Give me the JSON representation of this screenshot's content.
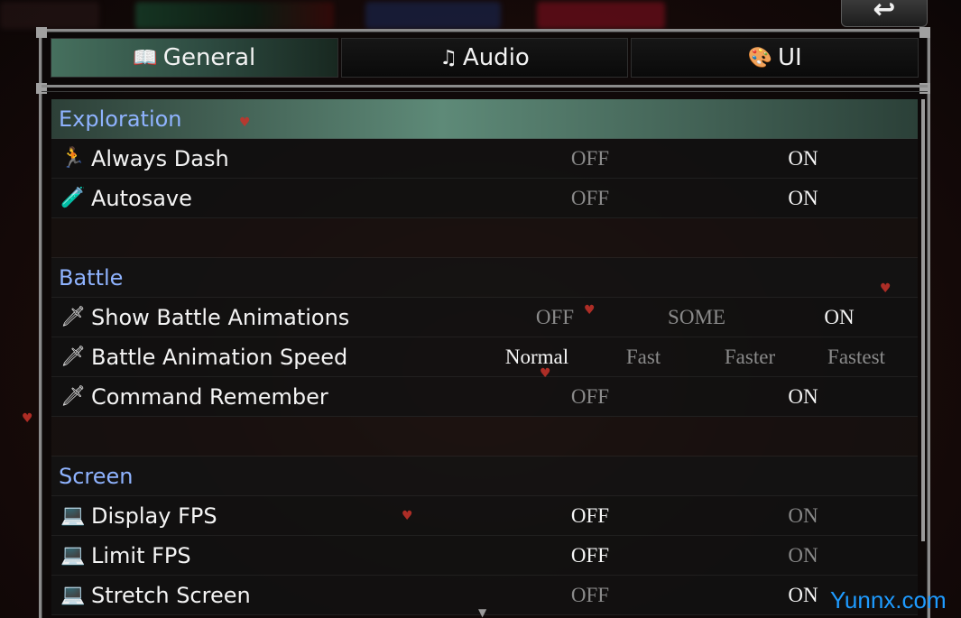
{
  "tabs": [
    {
      "label": "General",
      "icon": "book-icon",
      "glyph": "📖",
      "active": true
    },
    {
      "label": "Audio",
      "icon": "music-note-icon",
      "glyph": "♫",
      "active": false
    },
    {
      "label": "UI",
      "icon": "paint-icon",
      "glyph": "🎨",
      "active": false
    }
  ],
  "back": {
    "glyph": "↩"
  },
  "sections": [
    {
      "title": "Exploration",
      "options": [
        {
          "label": "Always Dash",
          "icon": "running-figure-icon",
          "glyph": "🏃",
          "values": [
            "OFF",
            "ON"
          ],
          "selected": 1
        },
        {
          "label": "Autosave",
          "icon": "potion-icon",
          "glyph": "🧪",
          "values": [
            "OFF",
            "ON"
          ],
          "selected": 1
        }
      ]
    },
    {
      "title": "Battle",
      "options": [
        {
          "label": "Show Battle Animations",
          "icon": "sword-icon",
          "glyph": "🗡",
          "values": [
            "OFF",
            "SOME",
            "ON"
          ],
          "selected": 2
        },
        {
          "label": "Battle Animation Speed",
          "icon": "sword-icon",
          "glyph": "🗡",
          "values": [
            "Normal",
            "Fast",
            "Faster",
            "Fastest"
          ],
          "selected": 0
        },
        {
          "label": "Command Remember",
          "icon": "sword-icon",
          "glyph": "🗡",
          "values": [
            "OFF",
            "ON"
          ],
          "selected": 1
        }
      ]
    },
    {
      "title": "Screen",
      "options": [
        {
          "label": "Display FPS",
          "icon": "monitor-icon",
          "glyph": "💻",
          "values": [
            "OFF",
            "ON"
          ],
          "selected": 0
        },
        {
          "label": "Limit FPS",
          "icon": "monitor-icon",
          "glyph": "💻",
          "values": [
            "OFF",
            "ON"
          ],
          "selected": 0
        },
        {
          "label": "Stretch Screen",
          "icon": "monitor-icon",
          "glyph": "💻",
          "values": [
            "OFF",
            "ON"
          ],
          "selected": 1
        }
      ]
    }
  ],
  "watermark": "Yunnx.com"
}
